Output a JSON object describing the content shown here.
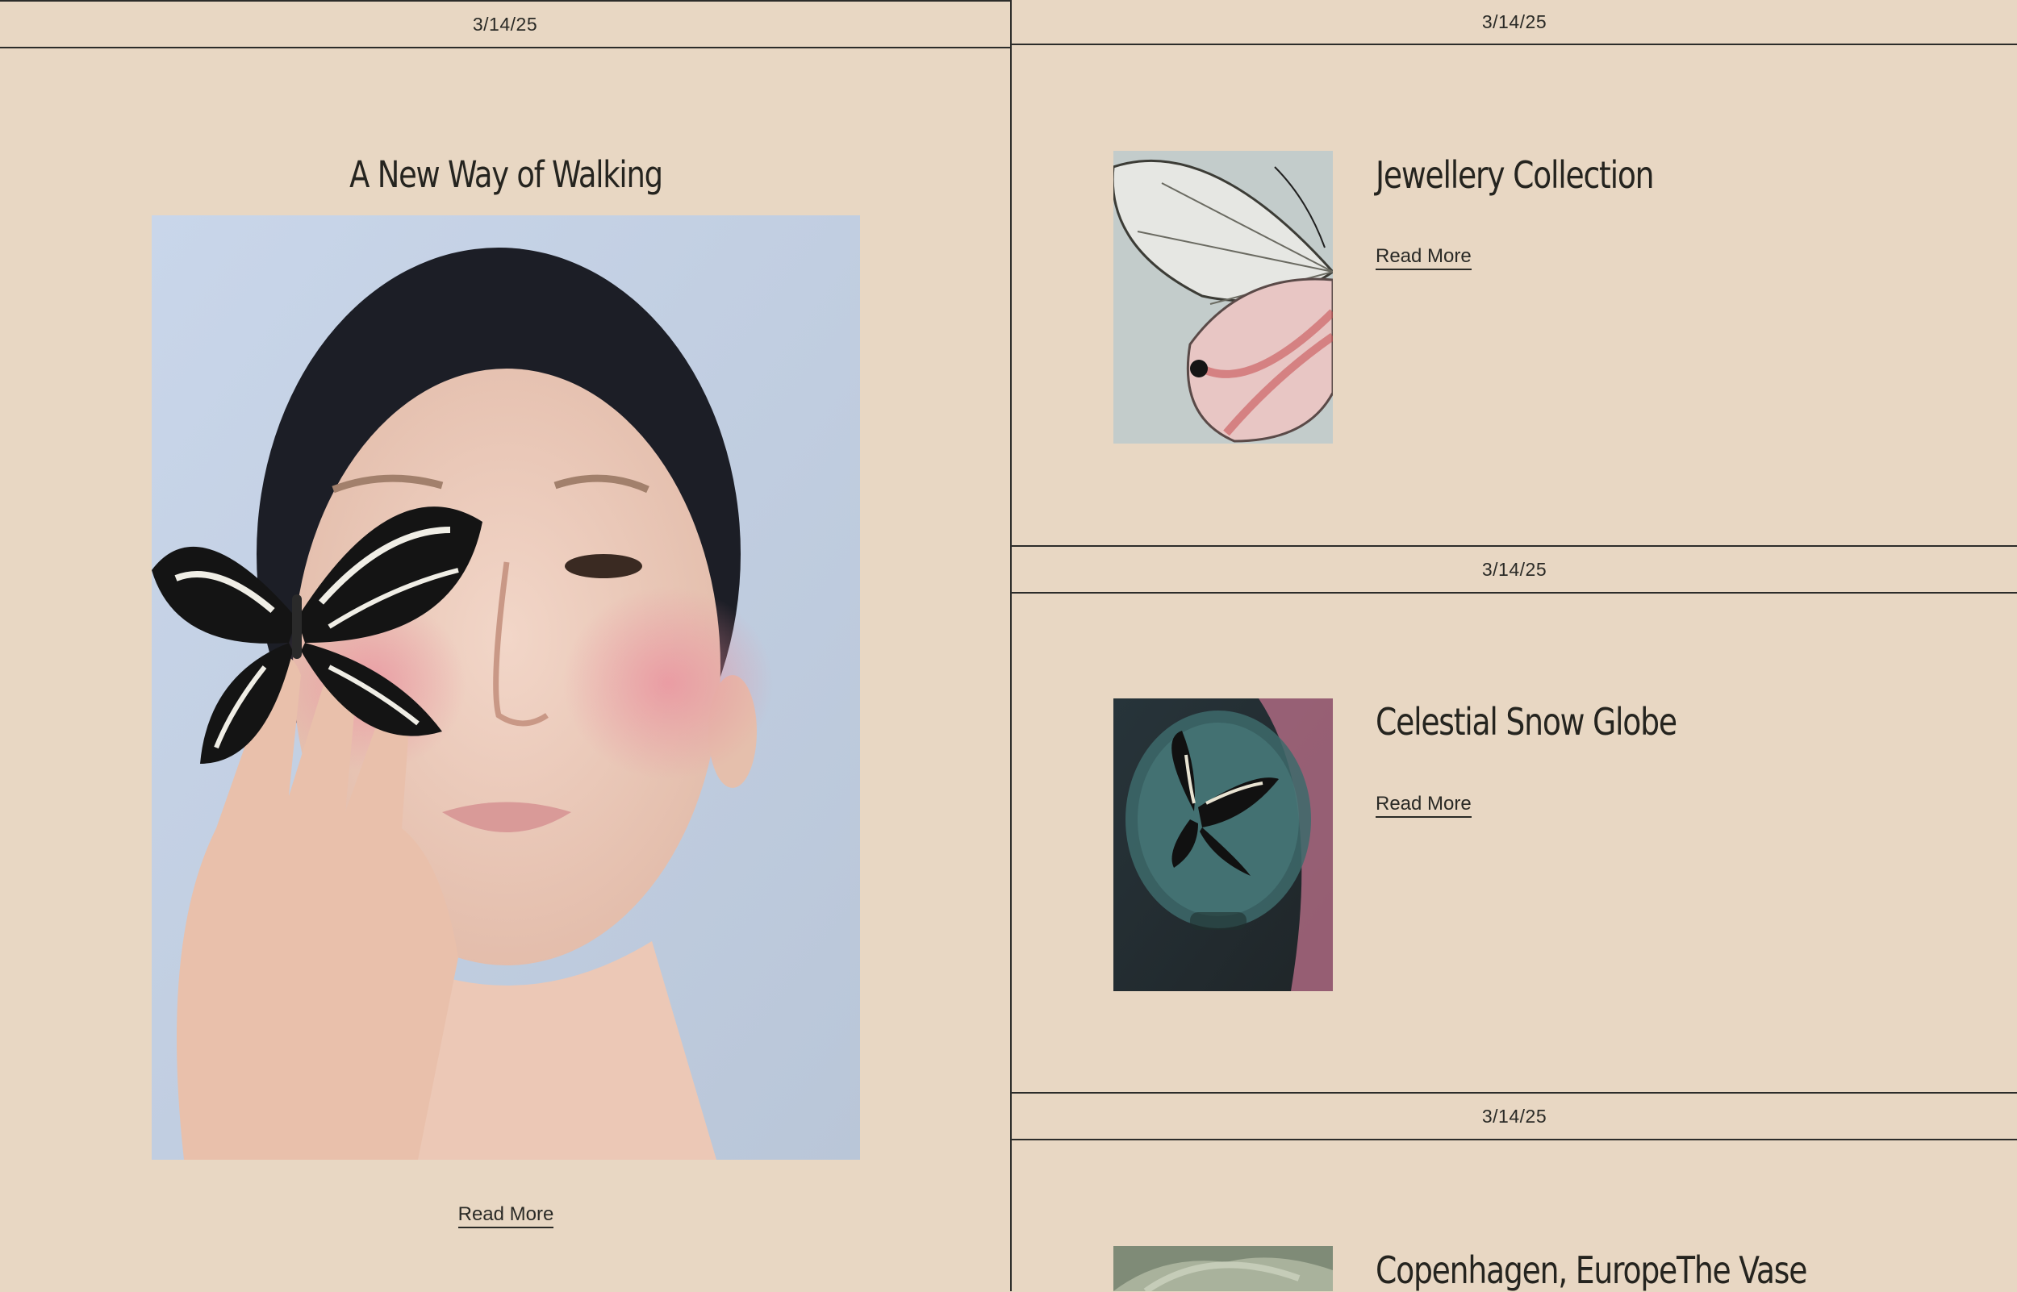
{
  "feature": {
    "date": "3/14/25",
    "title": "A New Way of Walking",
    "read_more": "Read More"
  },
  "cards": [
    {
      "date": "3/14/25",
      "title": "Jewellery Collection",
      "read_more": "Read More"
    },
    {
      "date": "3/14/25",
      "title": "Celestial Snow Globe",
      "read_more": "Read More"
    },
    {
      "date": "3/14/25",
      "title": "Copenhagen, EuropeThe Vase"
    }
  ],
  "colors": {
    "background": "#e8d7c3",
    "rule": "#2c2c2a",
    "text": "#2a2a26"
  }
}
